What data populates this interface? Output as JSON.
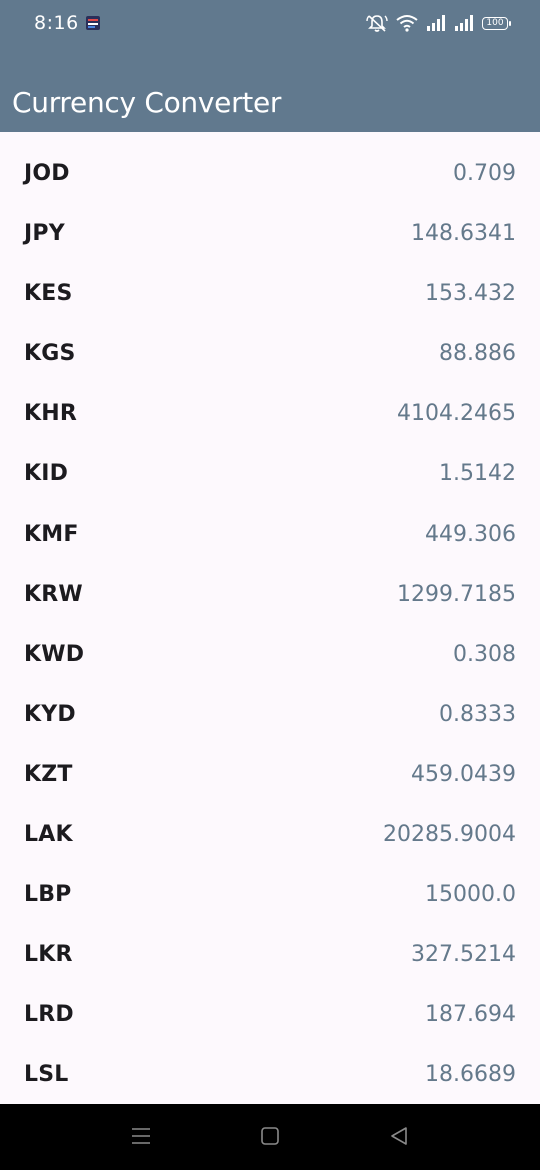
{
  "status_bar": {
    "time": "8:16",
    "battery": "100",
    "icons": [
      "notification-app-icon",
      "mute-icon",
      "wifi-icon",
      "signal-icon",
      "signal-icon",
      "battery-icon"
    ]
  },
  "app_bar": {
    "title": "Currency Converter",
    "background": "#61798e"
  },
  "rates": [
    {
      "code": "JOD",
      "value": "0.709"
    },
    {
      "code": "JPY",
      "value": "148.6341"
    },
    {
      "code": "KES",
      "value": "153.432"
    },
    {
      "code": "KGS",
      "value": "88.886"
    },
    {
      "code": "KHR",
      "value": "4104.2465"
    },
    {
      "code": "KID",
      "value": "1.5142"
    },
    {
      "code": "KMF",
      "value": "449.306"
    },
    {
      "code": "KRW",
      "value": "1299.7185"
    },
    {
      "code": "KWD",
      "value": "0.308"
    },
    {
      "code": "KYD",
      "value": "0.8333"
    },
    {
      "code": "KZT",
      "value": "459.0439"
    },
    {
      "code": "LAK",
      "value": "20285.9004"
    },
    {
      "code": "LBP",
      "value": "15000.0"
    },
    {
      "code": "LKR",
      "value": "327.5214"
    },
    {
      "code": "LRD",
      "value": "187.694"
    },
    {
      "code": "LSL",
      "value": "18.6689"
    }
  ],
  "nav_bar": {
    "buttons": [
      "menu-icon",
      "home-icon",
      "back-icon"
    ]
  }
}
